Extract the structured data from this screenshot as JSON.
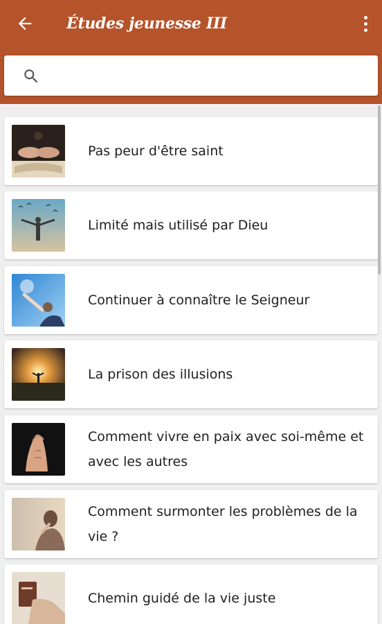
{
  "appbar": {
    "title": "Études jeunesse III",
    "back_icon": "arrow-back-icon",
    "menu_icon": "more-vert-icon",
    "color": "#b5532a"
  },
  "search": {
    "placeholder": "",
    "value": "",
    "icon": "search-icon"
  },
  "items": [
    {
      "title": "Pas peur d'être saint",
      "image": "hands-over-bible"
    },
    {
      "title": "Limité mais utilisé par Dieu",
      "image": "man-arms-open-birds"
    },
    {
      "title": "Continuer à connaître le Seigneur",
      "image": "woman-reaching-sky"
    },
    {
      "title": "La prison des illusions",
      "image": "sunset-field-figure"
    },
    {
      "title": "Comment vivre en paix avec soi-même et avec les autres",
      "image": "praying-hands-dark"
    },
    {
      "title": "Comment surmonter les problèmes de la vie ?",
      "image": "person-praying-window"
    },
    {
      "title": "Chemin guidé de la vie juste",
      "image": "holding-bible"
    }
  ]
}
